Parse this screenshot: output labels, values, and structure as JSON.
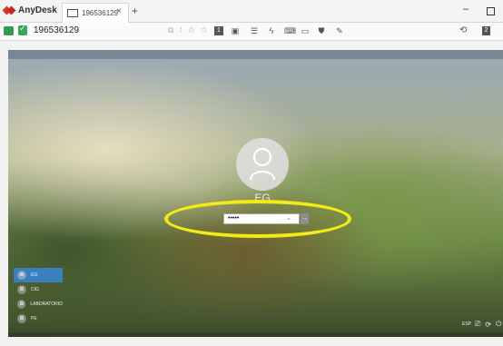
{
  "titlebar": {
    "app_name": "AnyDesk",
    "tab_label": "196536129",
    "tab_close": "×",
    "tab_add": "+",
    "minimize": "–"
  },
  "toolbar": {
    "address_id": "196536129",
    "action_number": "1",
    "right_badge": "2"
  },
  "lock_screen": {
    "username": "EG",
    "password_value": "•••••",
    "reveal_glyph": "⌄",
    "submit_glyph": "→"
  },
  "users": [
    {
      "label": "EG",
      "selected": true
    },
    {
      "label": "CIG",
      "selected": false
    },
    {
      "label": "LABORATORIO",
      "selected": false
    },
    {
      "label": "PE",
      "selected": false
    }
  ],
  "system_tray": {
    "language": "ESP"
  },
  "colors": {
    "anydesk_red": "#e0332b",
    "highlight_yellow": "#f3ea15",
    "selected_user": "#3a7fbf"
  },
  "icons": [
    "anydesk-logo-icon",
    "monitor-icon",
    "connection-icon",
    "verified-icon",
    "chat-icon",
    "lightning-icon",
    "keyboard-icon",
    "display-icon",
    "shield-icon",
    "pen-icon",
    "history-icon",
    "user-avatar-icon",
    "network-icon",
    "accessibility-icon",
    "power-icon"
  ]
}
